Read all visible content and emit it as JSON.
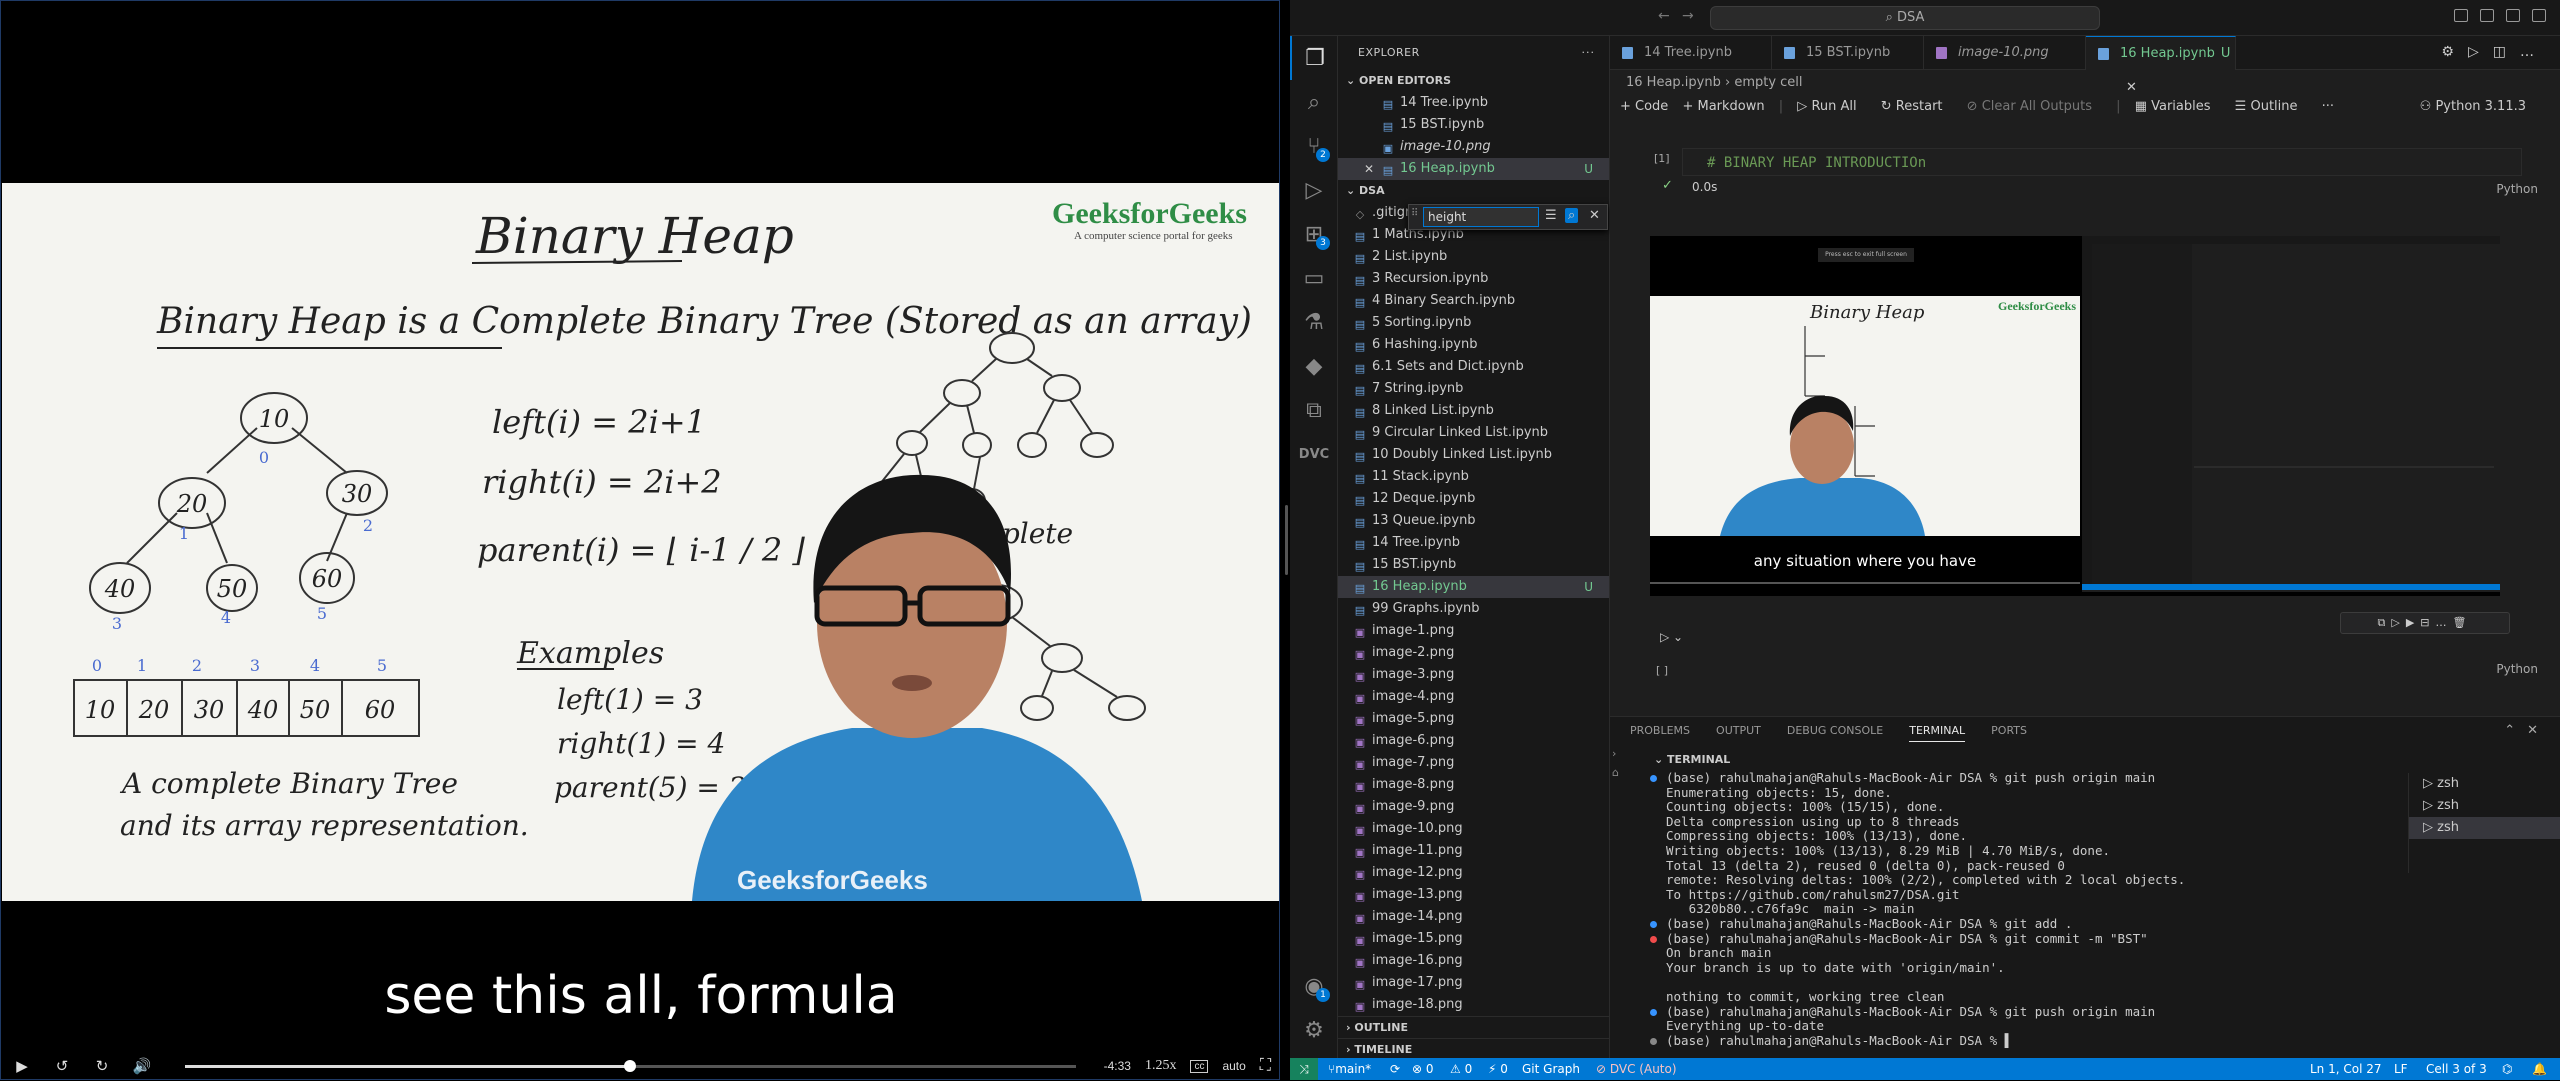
{
  "video": {
    "subtitle": "see this all, formula",
    "time_remaining": "-4:33",
    "speed": "1.25x",
    "quality": "auto",
    "progress_fraction": 0.5,
    "board": {
      "logo": "GeeksforGeeks",
      "logo_tag": "A computer science portal for geeks",
      "title": "Binary Heap",
      "definition": "Binary Heap is a Complete Binary Tree (Stored as an array)",
      "tree_nodes": [
        "10",
        "20",
        "30",
        "40",
        "50",
        "60"
      ],
      "node_indices": [
        "0",
        "1",
        "2",
        "3",
        "4",
        "5"
      ],
      "formula_left": "left(i) = 2i+1",
      "formula_right": "right(i) = 2i+2",
      "formula_parent": "parent(i) = ⌊ i-1 / 2 ⌋",
      "examples_title": "Examples",
      "example_1": "left(1) = 3",
      "example_2": "right(1) = 4",
      "example_3": "parent(5) = 2",
      "array_caption_1": "A complete Binary Tree",
      "array_caption_2": "and its array representation.",
      "complete_label": "Complete",
      "shirt_text": "GeeksforGeeks"
    }
  },
  "vscode": {
    "command_center": "DSA",
    "explorer_title": "EXPLORER",
    "open_editors_label": "OPEN EDITORS",
    "open_editors": [
      {
        "name": "14 Tree.ipynb",
        "status": ""
      },
      {
        "name": "15 BST.ipynb",
        "status": ""
      },
      {
        "name": "image-10.png",
        "status": ""
      },
      {
        "name": "16 Heap.ipynb",
        "status": "U"
      }
    ],
    "folder_label": "DSA",
    "find_value": "height",
    "files": [
      {
        "name": ".gitignore",
        "status": ""
      },
      {
        "name": "1 Maths.ipynb",
        "status": ""
      },
      {
        "name": "2 List.ipynb",
        "status": ""
      },
      {
        "name": "3 Recursion.ipynb",
        "status": ""
      },
      {
        "name": "4 Binary Search.ipynb",
        "status": ""
      },
      {
        "name": "5 Sorting.ipynb",
        "status": ""
      },
      {
        "name": "6 Hashing.ipynb",
        "status": ""
      },
      {
        "name": "6.1 Sets and Dict.ipynb",
        "status": ""
      },
      {
        "name": "7 String.ipynb",
        "status": ""
      },
      {
        "name": "8 Linked List.ipynb",
        "status": ""
      },
      {
        "name": "9 Circular Linked List.ipynb",
        "status": ""
      },
      {
        "name": "10 Doubly Linked List.ipynb",
        "status": ""
      },
      {
        "name": "11 Stack.ipynb",
        "status": ""
      },
      {
        "name": "12 Deque.ipynb",
        "status": ""
      },
      {
        "name": "13 Queue.ipynb",
        "status": ""
      },
      {
        "name": "14 Tree.ipynb",
        "status": ""
      },
      {
        "name": "15 BST.ipynb",
        "status": ""
      },
      {
        "name": "16 Heap.ipynb",
        "status": "U"
      },
      {
        "name": "99 Graphs.ipynb",
        "status": ""
      },
      {
        "name": "image-1.png",
        "status": ""
      },
      {
        "name": "image-2.png",
        "status": ""
      },
      {
        "name": "image-3.png",
        "status": ""
      },
      {
        "name": "image-4.png",
        "status": ""
      },
      {
        "name": "image-5.png",
        "status": ""
      },
      {
        "name": "image-6.png",
        "status": ""
      },
      {
        "name": "image-7.png",
        "status": ""
      },
      {
        "name": "image-8.png",
        "status": ""
      },
      {
        "name": "image-9.png",
        "status": ""
      },
      {
        "name": "image-10.png",
        "status": ""
      },
      {
        "name": "image-11.png",
        "status": ""
      },
      {
        "name": "image-12.png",
        "status": ""
      },
      {
        "name": "image-13.png",
        "status": ""
      },
      {
        "name": "image-14.png",
        "status": ""
      },
      {
        "name": "image-15.png",
        "status": ""
      },
      {
        "name": "image-16.png",
        "status": ""
      },
      {
        "name": "image-17.png",
        "status": ""
      },
      {
        "name": "image-18.png",
        "status": ""
      }
    ],
    "outline_label": "OUTLINE",
    "timeline_label": "TIMELINE",
    "tabs": [
      {
        "label": "14 Tree.ipynb",
        "modified": ""
      },
      {
        "label": "15 BST.ipynb",
        "modified": ""
      },
      {
        "label": "image-10.png",
        "modified": ""
      },
      {
        "label": "16 Heap.ipynb",
        "modified": "U"
      }
    ],
    "breadcrumb": [
      "16 Heap.ipynb",
      "empty cell"
    ],
    "notebook_toolbar": {
      "code": "+ Code",
      "markdown": "+ Markdown",
      "run_all": "Run All",
      "restart": "Restart",
      "clear": "Clear All Outputs",
      "variables": "Variables",
      "outline": "Outline",
      "more": "···",
      "kernel": "Python 3.11.3"
    },
    "cell1": {
      "code": "# BINARY HEAP INTRODUCTIOn",
      "count": "[1]",
      "duration": "0.0s",
      "lang": "Python"
    },
    "output_subtitle": "any situation where you have",
    "output_esc": "Press esc to exit full screen",
    "cell2": {
      "count": "[ ]",
      "lang": "Python"
    },
    "panel_tabs": [
      "PROBLEMS",
      "OUTPUT",
      "DEBUG CONSOLE",
      "TERMINAL",
      "PORTS"
    ],
    "terminal_label": "TERMINAL",
    "terminal_lines": [
      {
        "text": "(base) rahulmahajan@Rahuls-MacBook-Air DSA % git push origin main",
        "dot": "#3794ff"
      },
      {
        "text": "Enumerating objects: 15, done.",
        "dot": ""
      },
      {
        "text": "Counting objects: 100% (15/15), done.",
        "dot": ""
      },
      {
        "text": "Delta compression using up to 8 threads",
        "dot": ""
      },
      {
        "text": "Compressing objects: 100% (13/13), done.",
        "dot": ""
      },
      {
        "text": "Writing objects: 100% (13/13), 8.29 MiB | 4.70 MiB/s, done.",
        "dot": ""
      },
      {
        "text": "Total 13 (delta 2), reused 0 (delta 0), pack-reused 0",
        "dot": ""
      },
      {
        "text": "remote: Resolving deltas: 100% (2/2), completed with 2 local objects.",
        "dot": ""
      },
      {
        "text": "To https://github.com/rahulsm27/DSA.git",
        "dot": ""
      },
      {
        "text": "   6320b80..c76fa9c  main -> main",
        "dot": ""
      },
      {
        "text": "(base) rahulmahajan@Rahuls-MacBook-Air DSA % git add .",
        "dot": "#3794ff"
      },
      {
        "text": "(base) rahulmahajan@Rahuls-MacBook-Air DSA % git commit -m \"BST\"",
        "dot": "#f14c4c"
      },
      {
        "text": "On branch main",
        "dot": ""
      },
      {
        "text": "Your branch is up to date with 'origin/main'.",
        "dot": ""
      },
      {
        "text": "",
        "dot": ""
      },
      {
        "text": "nothing to commit, working tree clean",
        "dot": ""
      },
      {
        "text": "(base) rahulmahajan@Rahuls-MacBook-Air DSA % git push origin main",
        "dot": "#3794ff"
      },
      {
        "text": "Everything up-to-date",
        "dot": ""
      },
      {
        "text": "(base) rahulmahajan@Rahuls-MacBook-Air DSA % ▌",
        "dot": "#888888"
      }
    ],
    "shells": [
      "zsh",
      "zsh",
      "zsh"
    ],
    "status": {
      "branch": "main*",
      "sync": "⟳",
      "errors": "⊗ 0",
      "warnings": "⚠ 0",
      "ports": "⚡ 0",
      "git_graph": "Git Graph",
      "dvc": "⊘ DVC (Auto)",
      "position": "Ln 1, Col 27",
      "eol": "LF",
      "cell": "Cell 3 of 3"
    },
    "activity_badges": {
      "scm": "2",
      "extensions": "3",
      "accounts": "1"
    }
  }
}
